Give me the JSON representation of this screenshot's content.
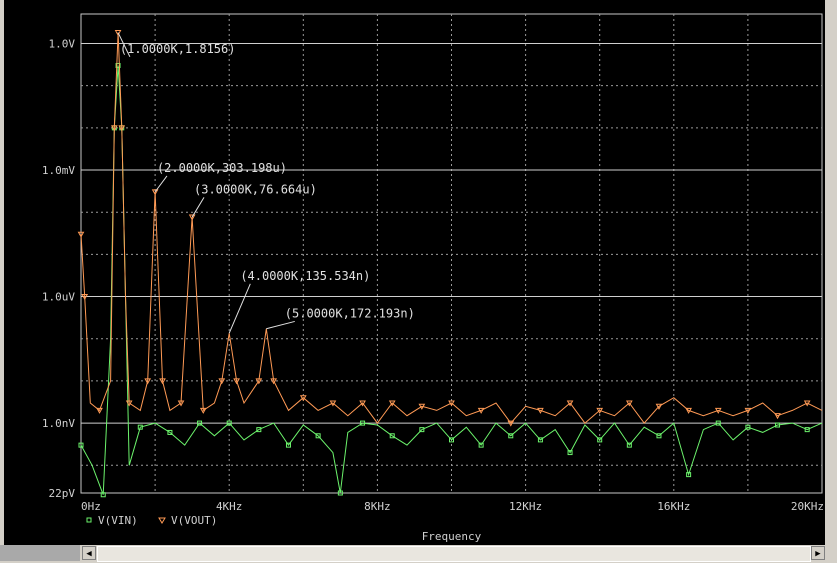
{
  "chart_data": {
    "type": "line",
    "x_axis_title": "Frequency",
    "x_ticks": [
      "0Hz",
      "4KHz",
      "8KHz",
      "12KHz",
      "16KHz",
      "20KHz"
    ],
    "x_tick_values": [
      0,
      4000,
      8000,
      12000,
      16000,
      20000
    ],
    "y_ticks": [
      "1.0V",
      "1.0mV",
      "1.0uV",
      "1.0nV",
      "22pV"
    ],
    "y_tick_values": [
      1,
      0.001,
      1e-06,
      1e-09,
      2.2e-11
    ],
    "y_scale": "log",
    "xlim": [
      0,
      20000
    ],
    "ylim": [
      2.2e-11,
      5
    ],
    "grid": true,
    "legend_position": "bottom-left",
    "series": [
      {
        "name": "V(VIN)",
        "color": "#6cf36c",
        "marker": "square",
        "points": [
          [
            0,
            3e-10
          ],
          [
            300,
            1e-10
          ],
          [
            600,
            2e-11
          ],
          [
            800,
            1e-07
          ],
          [
            900,
            0.01
          ],
          [
            1000,
            0.3
          ],
          [
            1100,
            0.01
          ],
          [
            1300,
            1e-10
          ],
          [
            1600,
            8e-10
          ],
          [
            2000,
            1e-09
          ],
          [
            2400,
            6e-10
          ],
          [
            2800,
            3e-10
          ],
          [
            3200,
            1e-09
          ],
          [
            3600,
            5e-10
          ],
          [
            4000,
            1e-09
          ],
          [
            4400,
            4e-10
          ],
          [
            4800,
            7e-10
          ],
          [
            5200,
            1e-09
          ],
          [
            5600,
            3e-10
          ],
          [
            6000,
            9e-10
          ],
          [
            6400,
            5e-10
          ],
          [
            6800,
            2e-10
          ],
          [
            7000,
            2.2e-11
          ],
          [
            7200,
            6e-10
          ],
          [
            7600,
            1e-09
          ],
          [
            8000,
            9e-10
          ],
          [
            8400,
            5e-10
          ],
          [
            8800,
            3e-10
          ],
          [
            9200,
            7e-10
          ],
          [
            9600,
            1e-09
          ],
          [
            10000,
            4e-10
          ],
          [
            10400,
            8e-10
          ],
          [
            10800,
            3e-10
          ],
          [
            11200,
            1e-09
          ],
          [
            11600,
            5e-10
          ],
          [
            12000,
            1e-09
          ],
          [
            12400,
            4e-10
          ],
          [
            12800,
            7e-10
          ],
          [
            13200,
            2e-10
          ],
          [
            13600,
            9e-10
          ],
          [
            14000,
            4e-10
          ],
          [
            14400,
            1e-09
          ],
          [
            14800,
            3e-10
          ],
          [
            15200,
            8e-10
          ],
          [
            15600,
            5e-10
          ],
          [
            16000,
            1e-09
          ],
          [
            16400,
            6e-11
          ],
          [
            16800,
            7e-10
          ],
          [
            17200,
            1e-09
          ],
          [
            17600,
            4e-10
          ],
          [
            18000,
            8e-10
          ],
          [
            18400,
            6e-10
          ],
          [
            18800,
            9e-10
          ],
          [
            19200,
            1e-09
          ],
          [
            19600,
            7e-10
          ],
          [
            20000,
            1e-09
          ]
        ]
      },
      {
        "name": "V(VOUT)",
        "color": "#ff9a55",
        "marker": "triangle",
        "points": [
          [
            0,
            3e-05
          ],
          [
            100,
            1e-06
          ],
          [
            250,
            3e-09
          ],
          [
            500,
            2e-09
          ],
          [
            800,
            1e-08
          ],
          [
            900,
            0.01
          ],
          [
            1000,
            1.8156
          ],
          [
            1100,
            0.01
          ],
          [
            1200,
            1e-06
          ],
          [
            1300,
            3e-09
          ],
          [
            1600,
            2e-09
          ],
          [
            1800,
            1e-08
          ],
          [
            2000,
            0.000303198
          ],
          [
            2200,
            1e-08
          ],
          [
            2400,
            2e-09
          ],
          [
            2700,
            3e-09
          ],
          [
            3000,
            7.6664e-05
          ],
          [
            3300,
            2e-09
          ],
          [
            3600,
            3e-09
          ],
          [
            3800,
            1e-08
          ],
          [
            4000,
            1.35534e-07
          ],
          [
            4200,
            1e-08
          ],
          [
            4400,
            3e-09
          ],
          [
            4800,
            1e-08
          ],
          [
            5000,
            1.72193e-07
          ],
          [
            5200,
            1e-08
          ],
          [
            5600,
            2e-09
          ],
          [
            6000,
            4e-09
          ],
          [
            6400,
            2e-09
          ],
          [
            6800,
            3e-09
          ],
          [
            7200,
            1.5e-09
          ],
          [
            7600,
            3e-09
          ],
          [
            8000,
            1e-09
          ],
          [
            8400,
            3e-09
          ],
          [
            8800,
            1.5e-09
          ],
          [
            9200,
            2.5e-09
          ],
          [
            9600,
            2e-09
          ],
          [
            10000,
            3e-09
          ],
          [
            10400,
            1.5e-09
          ],
          [
            10800,
            2e-09
          ],
          [
            11200,
            3e-09
          ],
          [
            11600,
            1e-09
          ],
          [
            12000,
            2.5e-09
          ],
          [
            12400,
            2e-09
          ],
          [
            12800,
            1.5e-09
          ],
          [
            13200,
            3e-09
          ],
          [
            13600,
            1e-09
          ],
          [
            14000,
            2e-09
          ],
          [
            14400,
            1.5e-09
          ],
          [
            14800,
            3e-09
          ],
          [
            15200,
            1e-09
          ],
          [
            15600,
            2.5e-09
          ],
          [
            16000,
            4e-09
          ],
          [
            16400,
            2e-09
          ],
          [
            16800,
            1.5e-09
          ],
          [
            17200,
            2e-09
          ],
          [
            17600,
            1.5e-09
          ],
          [
            18000,
            2e-09
          ],
          [
            18400,
            3e-09
          ],
          [
            18800,
            1.5e-09
          ],
          [
            19200,
            2e-09
          ],
          [
            19600,
            3e-09
          ],
          [
            20000,
            2e-09
          ]
        ]
      }
    ],
    "annotations": [
      {
        "x": 1000,
        "y": 1.8156,
        "text": "(1.0000K,1.8156)",
        "tx": 1050,
        "ty": 0.6
      },
      {
        "x": 2000,
        "y": 0.000303198,
        "text": "(2.0000K,303.198u)",
        "tx": 2050,
        "ty": 0.0009
      },
      {
        "x": 3000,
        "y": 7.6664e-05,
        "text": "(3.0000K,76.664u)",
        "tx": 3050,
        "ty": 0.00028
      },
      {
        "x": 4000,
        "y": 1.35534e-07,
        "text": "(4.0000K,135.534n)",
        "tx": 4300,
        "ty": 2.5e-06
      },
      {
        "x": 5000,
        "y": 1.72193e-07,
        "text": "(5.0000K,172.193n)",
        "tx": 5500,
        "ty": 3.2e-07
      }
    ]
  }
}
